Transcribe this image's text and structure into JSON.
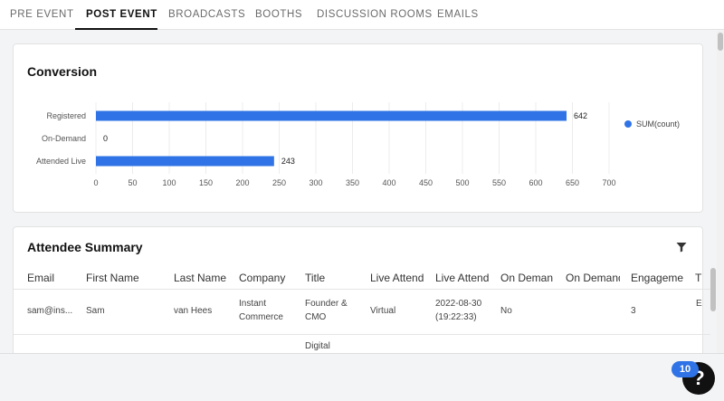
{
  "tabs": [
    {
      "label": "PRE EVENT",
      "active": false
    },
    {
      "label": "POST EVENT",
      "active": true
    },
    {
      "label": "BROADCASTS",
      "active": false
    },
    {
      "label": "BOOTHS",
      "active": false
    },
    {
      "label": "DISCUSSION ROOMS",
      "active": false
    },
    {
      "label": "EMAILS",
      "active": false
    }
  ],
  "conversion": {
    "title": "Conversion"
  },
  "chart_data": {
    "type": "bar",
    "orientation": "horizontal",
    "categories": [
      "Registered",
      "On-Demand",
      "Attended Live"
    ],
    "series": [
      {
        "name": "SUM(count)",
        "values": [
          642,
          0,
          243
        ],
        "color": "#2f73e6"
      }
    ],
    "data_labels": [
      "642",
      "0",
      "243"
    ],
    "xlim": [
      0,
      700
    ],
    "x_ticks": [
      0,
      50,
      100,
      150,
      200,
      250,
      300,
      350,
      400,
      450,
      500,
      550,
      600,
      650,
      700
    ],
    "grid": true,
    "legend": "right"
  },
  "attendee_summary": {
    "title": "Attendee Summary",
    "filter_icon": "filter-icon",
    "columns": [
      "Email",
      "First Name",
      "Last Name",
      "Company",
      "Title",
      "Live Attend",
      "Live Attend",
      "On Demand",
      "On Demand",
      "Engagemen",
      "T"
    ],
    "rows": [
      [
        "sam@ins...",
        "Sam",
        "van Hees",
        "Instant\nCommerce",
        "Founder &\nCMO",
        "Virtual",
        "2022-08-30\n(19:22:33)",
        "No",
        "",
        "3",
        "E"
      ],
      [
        "",
        "",
        "",
        "",
        "Digital",
        "",
        "",
        "",
        "",
        "",
        ""
      ]
    ]
  },
  "help": {
    "icon": "?",
    "badge_count": "10"
  }
}
